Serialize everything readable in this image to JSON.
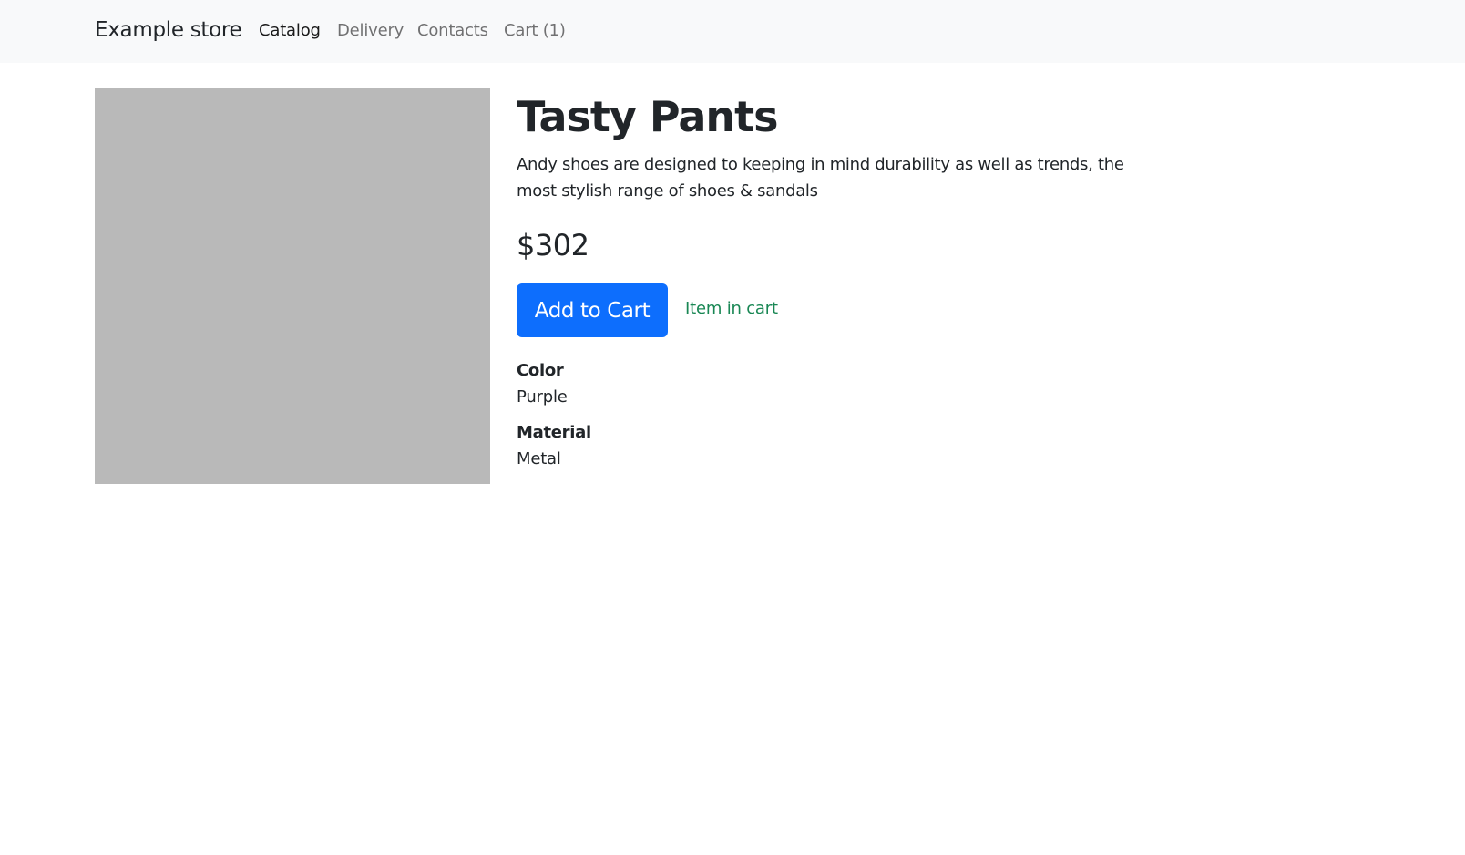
{
  "navbar": {
    "brand": "Example store",
    "links": [
      {
        "label": "Catalog",
        "active": true
      },
      {
        "label": "Delivery",
        "active": false
      },
      {
        "label": "Contacts",
        "active": false
      },
      {
        "label": "Cart (1)",
        "active": false
      }
    ]
  },
  "product": {
    "title": "Tasty Pants",
    "description": "Andy shoes are designed to keeping in mind durability as well as trends, the most stylish range of shoes & sandals",
    "price": "$302",
    "add_to_cart_label": "Add to Cart",
    "in_cart_text": "Item in cart",
    "specs": [
      {
        "label": "Color",
        "value": "Purple"
      },
      {
        "label": "Material",
        "value": "Metal"
      }
    ]
  },
  "colors": {
    "navbar_bg": "#f8f9fa",
    "primary": "#0d6efd",
    "success": "#198754",
    "image_placeholder": "#b9b9b9"
  }
}
